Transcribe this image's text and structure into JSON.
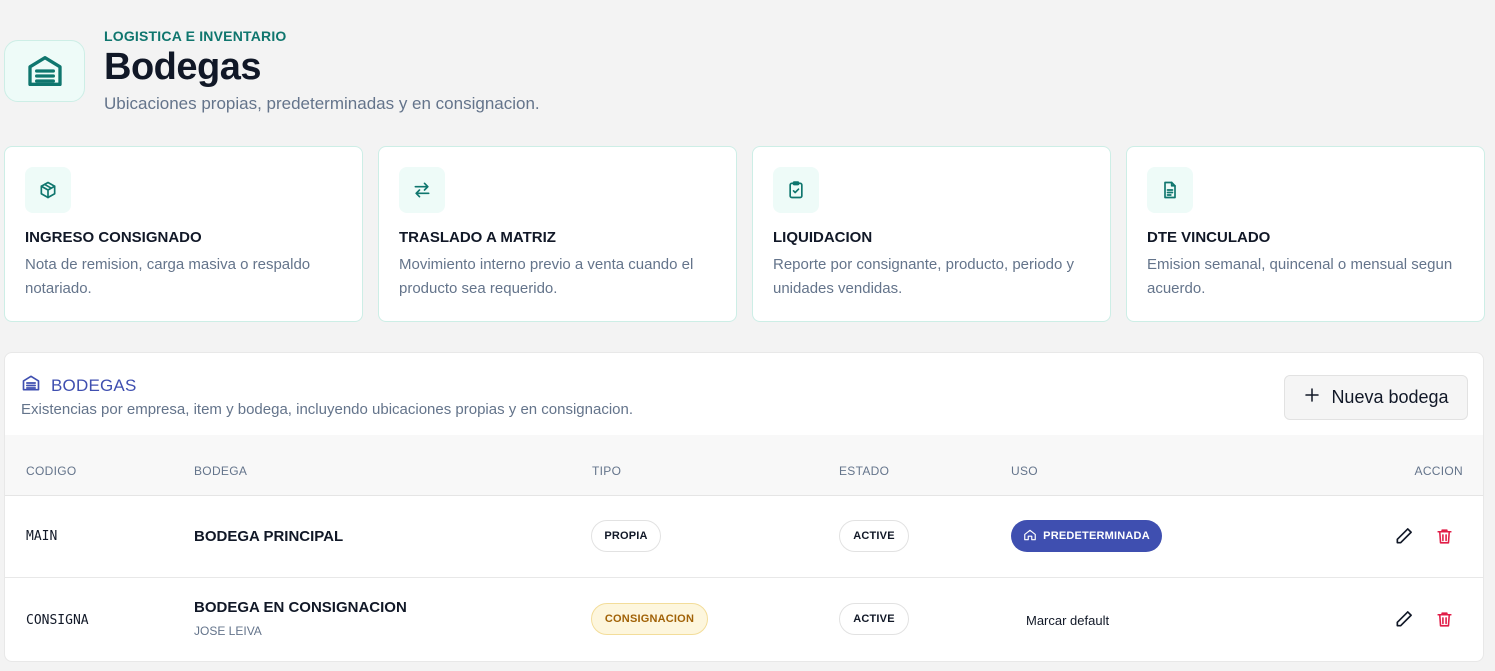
{
  "header": {
    "eyebrow": "LOGISTICA E INVENTARIO",
    "title": "Bodegas",
    "subtitle": "Ubicaciones propias, predeterminadas y en consignacion.",
    "icon": "warehouse-icon"
  },
  "cards": [
    {
      "icon": "box-icon",
      "title": "INGRESO CONSIGNADO",
      "desc": "Nota de remision, carga masiva o respaldo notariado."
    },
    {
      "icon": "transfer-arrows-icon",
      "title": "TRASLADO A MATRIZ",
      "desc": "Movimiento interno previo a venta cuando el producto sea requerido."
    },
    {
      "icon": "clipboard-check-icon",
      "title": "LIQUIDACION",
      "desc": "Reporte por consignante, producto, periodo y unidades vendidas."
    },
    {
      "icon": "document-icon",
      "title": "DTE VINCULADO",
      "desc": "Emision semanal, quincenal o mensual segun acuerdo."
    }
  ],
  "panel": {
    "title": "BODEGAS",
    "desc": "Existencias por empresa, item y bodega, incluyendo ubicaciones propias y en consignacion.",
    "new_button": "Nueva bodega"
  },
  "table": {
    "columns": [
      "CODIGO",
      "BODEGA",
      "TIPO",
      "ESTADO",
      "USO",
      "ACCION"
    ],
    "rows": [
      {
        "code": "MAIN",
        "name": "BODEGA PRINCIPAL",
        "sub": "",
        "type": "PROPIA",
        "status": "ACTIVE",
        "use": "PREDETERMINADA"
      },
      {
        "code": "CONSIGNA",
        "name": "BODEGA EN CONSIGNACION",
        "sub": "JOSE LEIVA",
        "type": "CONSIGNACION",
        "status": "ACTIVE",
        "use": "Marcar default"
      }
    ]
  },
  "colors": {
    "accent": "#0f766e",
    "primary": "#3f4fb0",
    "danger": "#e11d48",
    "warning": "#a16207"
  }
}
